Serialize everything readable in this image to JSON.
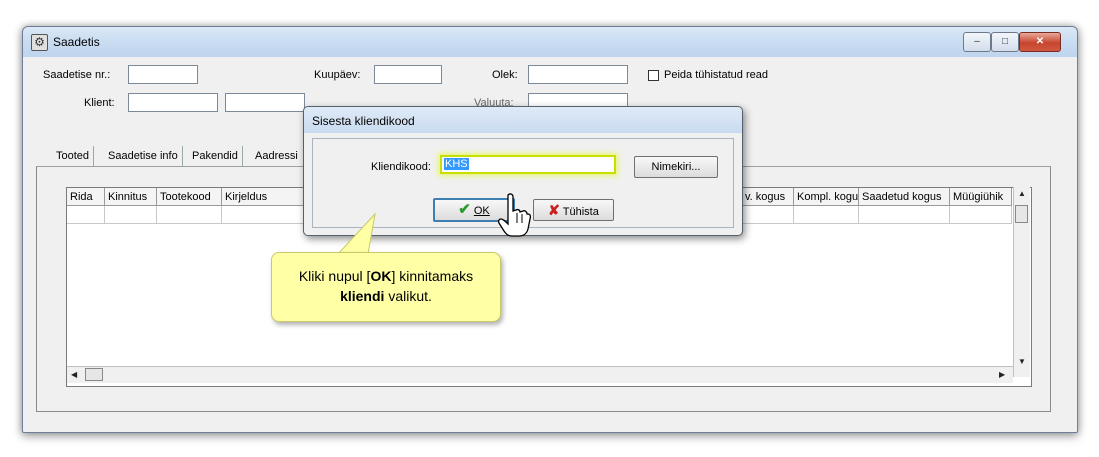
{
  "window": {
    "title": "Saadetis",
    "icon": "app-gear-icon",
    "controls": {
      "minimize": "–",
      "maximize": "□",
      "close": "✕"
    }
  },
  "form": {
    "saadetise_nr_label": "Saadetise nr.:",
    "saadetise_nr_value": "",
    "kuupaev_label": "Kuupäev:",
    "kuupaev_value": "",
    "olek_label": "Olek:",
    "olek_value": "",
    "peida_label": "Peida tühistatud read",
    "peida_checked": false,
    "klient_label": "Klient:",
    "klient_code_value": "",
    "klient_name_value": "",
    "valuuta_label": "Valuuta:",
    "valuuta_value": ""
  },
  "tabs": [
    "Tooted",
    "Saadetise info",
    "Pakendid",
    "Aadressi"
  ],
  "active_tab": "Tooted",
  "grid": {
    "columns_left": [
      "Rida",
      "Kinnitus",
      "Tootekood",
      "Kirjeldus"
    ],
    "columns_right": [
      "v. kogus",
      "Kompl. kogu",
      "Saadetud kogus",
      "Müügiühik"
    ]
  },
  "dialog": {
    "title": "Sisesta kliendikood",
    "field_label": "Kliendikood:",
    "field_value": "KHS",
    "list_button": "Nimekiri...",
    "ok_button": "OK",
    "cancel_button": "Tühista",
    "ok_icon": "checkmark-icon",
    "cancel_icon": "x-icon"
  },
  "callout": {
    "pre": "Kliki nupul [",
    "bold1": "OK",
    "mid": "] kinnitamaks",
    "bold2": "kliendi",
    "post": " valikut."
  },
  "colors": {
    "callout_bg": "#ffffa6",
    "highlight": "#c8e000",
    "selection": "#3399ff",
    "ok_check": "#2e9a2e",
    "cancel_x": "#cc1f1f"
  }
}
